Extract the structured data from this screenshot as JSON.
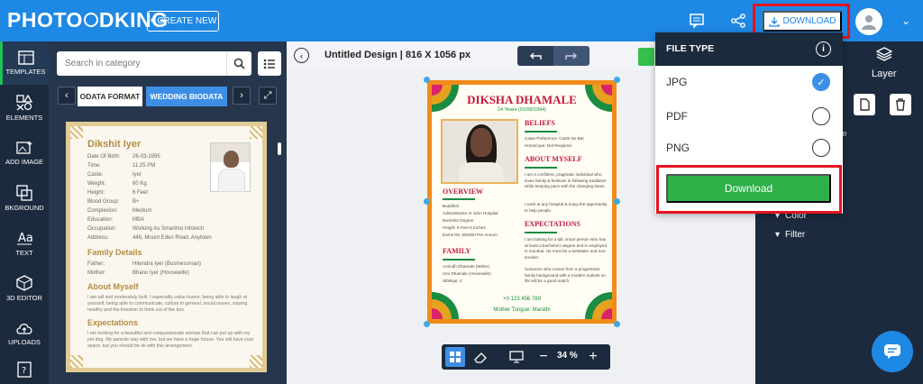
{
  "header": {
    "logo": "PHOTO ADKING",
    "create_new": "+ CREATE NEW",
    "download": "DOWNLOAD"
  },
  "left_nav": {
    "items": [
      {
        "label": "TEMPLATES",
        "icon": "templates-icon"
      },
      {
        "label": "ELEMENTS",
        "icon": "elements-icon"
      },
      {
        "label": "ADD IMAGE",
        "icon": "add-image-icon"
      },
      {
        "label": "BKGROUND",
        "icon": "background-icon"
      },
      {
        "label": "TEXT",
        "icon": "text-icon"
      },
      {
        "label": "3D EDITOR",
        "icon": "3d-editor-icon"
      },
      {
        "label": "UPLOADS",
        "icon": "uploads-icon"
      }
    ]
  },
  "category_panel": {
    "search_placeholder": "Search in category",
    "tabs": [
      "ODATA FORMAT",
      "WEDDING BIODATA"
    ]
  },
  "thumbnail": {
    "name": "Dikshit Iyer",
    "rows": [
      {
        "k": "Date Of Birth:",
        "v": "26-03-1995"
      },
      {
        "k": "Time:",
        "v": "11:25 PM"
      },
      {
        "k": "Caste:",
        "v": "Iyer"
      },
      {
        "k": "Weight:",
        "v": "60 Kg"
      },
      {
        "k": "Height:",
        "v": "6 Feet"
      },
      {
        "k": "Blood Group:",
        "v": "B+"
      },
      {
        "k": "Complexion:",
        "v": "Medium"
      },
      {
        "k": "Education:",
        "v": "MBA"
      },
      {
        "k": "Occupation:",
        "v": "Working As Smartmo Infotech"
      },
      {
        "k": "Address:",
        "v": "446, Mount Eden Road, Anytown"
      }
    ],
    "family_title": "Family Details",
    "family_rows": [
      {
        "k": "Father:",
        "v": "Hitendra Iyer (Businessman)"
      },
      {
        "k": "Mother:",
        "v": "Bhanu Iyer (Housewife)"
      }
    ],
    "about_title": "About Myself",
    "about_text": "I am tall and moderately built. I especially value humor, being able to laugh at yourself, being able to communicate, culture in general, social issues, staying healthy and the freedom to think out of the box.",
    "expect_title": "Expectations",
    "expect_text": "I am looking for a beautiful and compassionate woman that can put up with my pet dog. My parents stay with me, but we have a huge house. You will have your space, but you should be ok with this arrangement."
  },
  "canvas": {
    "doc_title": "Untitled Design | 816 X 1056 px",
    "zoom": "34 %"
  },
  "design": {
    "name": "DIKSHA DHAMALE",
    "age": "24 Years (01/09/1994)",
    "beliefs_title": "BELIEFS",
    "beliefs": [
      "Caste Preference: Caste No Bar",
      "Horoscope: Not Required"
    ],
    "about_title": "ABOUT MYSELF",
    "about": "I am a confident, pragmatic individual who loves family & believes in following traditions while keeping pace with the changing times.",
    "about2": "I work at any hospital & enjoy the opportunity to help people.",
    "overview_title": "OVERVIEW",
    "overview": [
      "Buddhist",
      "Administrator At John Hospital",
      "Bachelor Degree",
      "Height: 5 Feet 6 Inches",
      "Earns Rs. 550000 Per Annum"
    ],
    "expect_title": "EXPECTATIONS",
    "expect": "I am looking for a tall, smart person who has at least a bachelor's degree and is employed in mumbai. He must be a teetotaler and non-smoker.",
    "expect2": "Someone who comes from a progressive family background with a modern outlook on life will be a good match.",
    "family_title": "FAMILY",
    "family": [
      "Anirudh Dhamale (Writer)",
      "Urvi Dhamale (Housewife)",
      "Siblings: 4"
    ],
    "phone": "+0 123 456 789",
    "tongue": "Mother Tongue: Marathi"
  },
  "download_menu": {
    "title": "FILE TYPE",
    "options": [
      "JPG",
      "PDF",
      "PNG"
    ],
    "selected": "JPG",
    "button": "Download"
  },
  "right_panel": {
    "layer_label": "Layer",
    "ze_text": "ze",
    "items": [
      "Color",
      "Filter"
    ]
  }
}
